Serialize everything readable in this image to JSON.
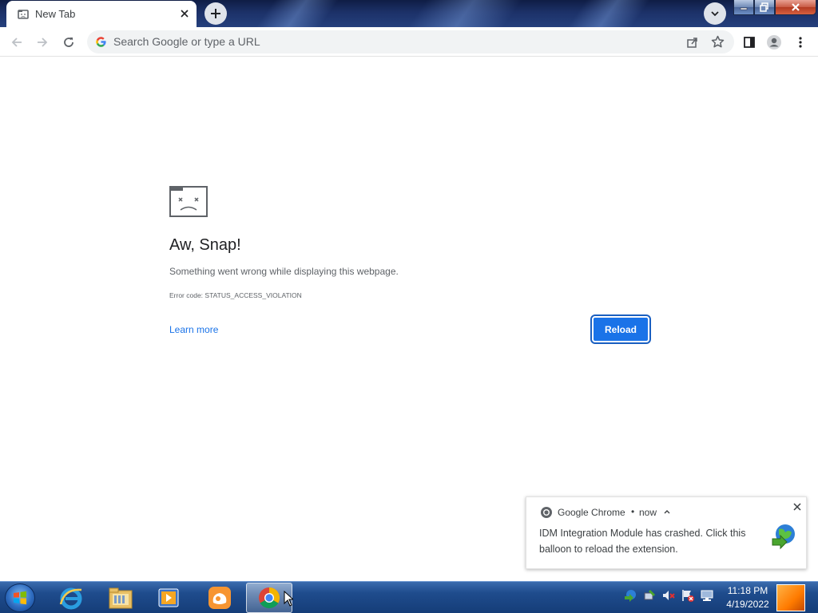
{
  "browser": {
    "tab": {
      "title": "New Tab"
    },
    "omnibox": {
      "placeholder": "Search Google or type a URL"
    }
  },
  "error_page": {
    "title": "Aw, Snap!",
    "message": "Something went wrong while displaying this webpage.",
    "error_code": "Error code: STATUS_ACCESS_VIOLATION",
    "learn_more": "Learn more",
    "reload": "Reload"
  },
  "notification": {
    "app": "Google Chrome",
    "separator": "•",
    "time": "now",
    "body": "IDM Integration Module has crashed. Click this balloon to reload the extension."
  },
  "taskbar": {
    "apps": [
      "windows-start",
      "internet-explorer",
      "windows-explorer",
      "media-player",
      "uc-browser",
      "google-chrome"
    ],
    "clock": {
      "time": "11:18 PM",
      "date": "4/19/2022"
    }
  },
  "colors": {
    "accent": "#1a73e8",
    "taskbar": "#1f4c8d"
  }
}
